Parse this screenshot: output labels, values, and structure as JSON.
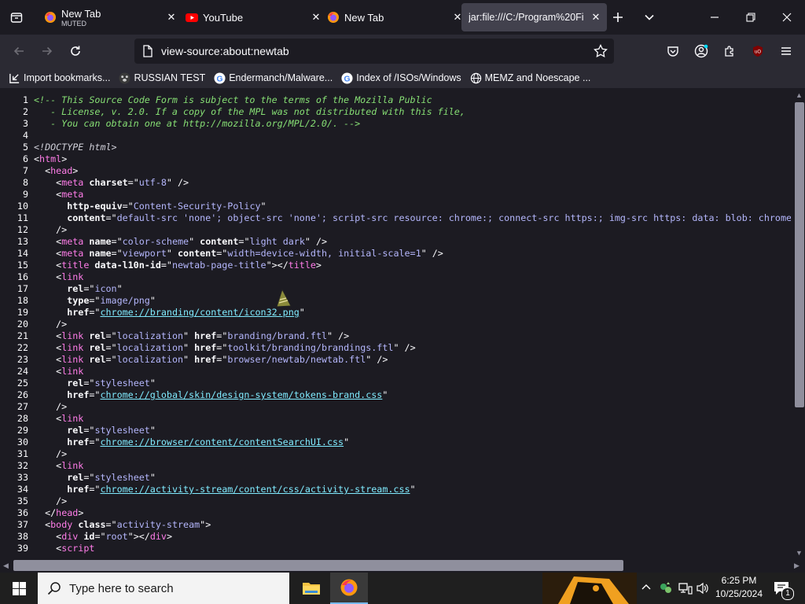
{
  "tabs": [
    {
      "title": "New Tab",
      "subtitle": "MUTED",
      "favicon": "firefox-icon"
    },
    {
      "title": "YouTube",
      "favicon": "youtube-icon"
    },
    {
      "title": "New Tab",
      "favicon": "firefox-icon"
    },
    {
      "title": "jar:file:///C:/Program%20Fi",
      "favicon": "none",
      "active": true
    }
  ],
  "urlbar": {
    "value": "view-source:about:newtab"
  },
  "bookmarks": [
    {
      "label": "Import bookmarks...",
      "icon": "import-icon"
    },
    {
      "label": "RUSSIAN TEST",
      "icon": "paw-icon"
    },
    {
      "label": "Endermanch/Malware...",
      "icon": "google-icon"
    },
    {
      "label": "Index of /ISOs/Windows",
      "icon": "google-icon"
    },
    {
      "label": "MEMZ and Noescape ...",
      "icon": "globe-icon"
    }
  ],
  "source_lines": [
    {
      "n": "1",
      "parts": [
        [
          "cmt",
          "<!-- This Source Code Form is subject to the terms of the Mozilla Public"
        ]
      ]
    },
    {
      "n": "2",
      "parts": [
        [
          "cmt",
          "   - License, v. 2.0. If a copy of the MPL was not distributed with this file,"
        ]
      ]
    },
    {
      "n": "3",
      "parts": [
        [
          "cmt",
          "   - You can obtain one at http://mozilla.org/MPL/2.0/. -->"
        ]
      ]
    },
    {
      "n": "4",
      "parts": []
    },
    {
      "n": "5",
      "parts": [
        [
          "dt",
          "<!DOCTYPE html>"
        ]
      ]
    },
    {
      "n": "6",
      "parts": [
        [
          "txt",
          "<"
        ],
        [
          "tag",
          "html"
        ],
        [
          "txt",
          ">"
        ]
      ]
    },
    {
      "n": "7",
      "parts": [
        [
          "txt",
          "  <"
        ],
        [
          "tag",
          "head"
        ],
        [
          "txt",
          ">"
        ]
      ]
    },
    {
      "n": "8",
      "parts": [
        [
          "txt",
          "    <"
        ],
        [
          "tag",
          "meta"
        ],
        [
          "txt",
          " "
        ],
        [
          "attr",
          "charset"
        ],
        [
          "txt",
          "=\""
        ],
        [
          "val",
          "utf-8"
        ],
        [
          "txt",
          "\" />"
        ]
      ]
    },
    {
      "n": "9",
      "parts": [
        [
          "txt",
          "    <"
        ],
        [
          "tag",
          "meta"
        ]
      ]
    },
    {
      "n": "10",
      "parts": [
        [
          "txt",
          "      "
        ],
        [
          "attr",
          "http-equiv"
        ],
        [
          "txt",
          "=\""
        ],
        [
          "val",
          "Content-Security-Policy"
        ],
        [
          "txt",
          "\""
        ]
      ]
    },
    {
      "n": "11",
      "parts": [
        [
          "txt",
          "      "
        ],
        [
          "attr",
          "content"
        ],
        [
          "txt",
          "=\""
        ],
        [
          "val",
          "default-src 'none'; object-src 'none'; script-src resource: chrome:; connect-src https:; img-src https: data: blob: chrome:"
        ]
      ]
    },
    {
      "n": "12",
      "parts": [
        [
          "txt",
          "    />"
        ]
      ]
    },
    {
      "n": "13",
      "parts": [
        [
          "txt",
          "    <"
        ],
        [
          "tag",
          "meta"
        ],
        [
          "txt",
          " "
        ],
        [
          "attr",
          "name"
        ],
        [
          "txt",
          "=\""
        ],
        [
          "val",
          "color-scheme"
        ],
        [
          "txt",
          "\" "
        ],
        [
          "attr",
          "content"
        ],
        [
          "txt",
          "=\""
        ],
        [
          "val",
          "light dark"
        ],
        [
          "txt",
          "\" />"
        ]
      ]
    },
    {
      "n": "14",
      "parts": [
        [
          "txt",
          "    <"
        ],
        [
          "tag",
          "meta"
        ],
        [
          "txt",
          " "
        ],
        [
          "attr",
          "name"
        ],
        [
          "txt",
          "=\""
        ],
        [
          "val",
          "viewport"
        ],
        [
          "txt",
          "\" "
        ],
        [
          "attr",
          "content"
        ],
        [
          "txt",
          "=\""
        ],
        [
          "val",
          "width=device-width, initial-scale=1"
        ],
        [
          "txt",
          "\" />"
        ]
      ]
    },
    {
      "n": "15",
      "parts": [
        [
          "txt",
          "    <"
        ],
        [
          "tag",
          "title"
        ],
        [
          "txt",
          " "
        ],
        [
          "attr",
          "data-l10n-id"
        ],
        [
          "txt",
          "=\""
        ],
        [
          "val",
          "newtab-page-title"
        ],
        [
          "txt",
          "\"></"
        ],
        [
          "tag",
          "title"
        ],
        [
          "txt",
          ">"
        ]
      ]
    },
    {
      "n": "16",
      "parts": [
        [
          "txt",
          "    <"
        ],
        [
          "tag",
          "link"
        ]
      ]
    },
    {
      "n": "17",
      "parts": [
        [
          "txt",
          "      "
        ],
        [
          "attr",
          "rel"
        ],
        [
          "txt",
          "=\""
        ],
        [
          "val",
          "icon"
        ],
        [
          "txt",
          "\""
        ]
      ]
    },
    {
      "n": "18",
      "parts": [
        [
          "txt",
          "      "
        ],
        [
          "attr",
          "type"
        ],
        [
          "txt",
          "=\""
        ],
        [
          "val",
          "image/png"
        ],
        [
          "txt",
          "\""
        ]
      ]
    },
    {
      "n": "19",
      "parts": [
        [
          "txt",
          "      "
        ],
        [
          "attr",
          "href"
        ],
        [
          "txt",
          "=\""
        ],
        [
          "lnk",
          "chrome://branding/content/icon32.png"
        ],
        [
          "txt",
          "\""
        ]
      ]
    },
    {
      "n": "20",
      "parts": [
        [
          "txt",
          "    />"
        ]
      ]
    },
    {
      "n": "21",
      "parts": [
        [
          "txt",
          "    <"
        ],
        [
          "tag",
          "link"
        ],
        [
          "txt",
          " "
        ],
        [
          "attr",
          "rel"
        ],
        [
          "txt",
          "=\""
        ],
        [
          "val",
          "localization"
        ],
        [
          "txt",
          "\" "
        ],
        [
          "attr",
          "href"
        ],
        [
          "txt",
          "=\""
        ],
        [
          "val",
          "branding/brand.ftl"
        ],
        [
          "txt",
          "\" />"
        ]
      ]
    },
    {
      "n": "22",
      "parts": [
        [
          "txt",
          "    <"
        ],
        [
          "tag",
          "link"
        ],
        [
          "txt",
          " "
        ],
        [
          "attr",
          "rel"
        ],
        [
          "txt",
          "=\""
        ],
        [
          "val",
          "localization"
        ],
        [
          "txt",
          "\" "
        ],
        [
          "attr",
          "href"
        ],
        [
          "txt",
          "=\""
        ],
        [
          "val",
          "toolkit/branding/brandings.ftl"
        ],
        [
          "txt",
          "\" />"
        ]
      ]
    },
    {
      "n": "23",
      "parts": [
        [
          "txt",
          "    <"
        ],
        [
          "tag",
          "link"
        ],
        [
          "txt",
          " "
        ],
        [
          "attr",
          "rel"
        ],
        [
          "txt",
          "=\""
        ],
        [
          "val",
          "localization"
        ],
        [
          "txt",
          "\" "
        ],
        [
          "attr",
          "href"
        ],
        [
          "txt",
          "=\""
        ],
        [
          "val",
          "browser/newtab/newtab.ftl"
        ],
        [
          "txt",
          "\" />"
        ]
      ]
    },
    {
      "n": "24",
      "parts": [
        [
          "txt",
          "    <"
        ],
        [
          "tag",
          "link"
        ]
      ]
    },
    {
      "n": "25",
      "parts": [
        [
          "txt",
          "      "
        ],
        [
          "attr",
          "rel"
        ],
        [
          "txt",
          "=\""
        ],
        [
          "val",
          "stylesheet"
        ],
        [
          "txt",
          "\""
        ]
      ]
    },
    {
      "n": "26",
      "parts": [
        [
          "txt",
          "      "
        ],
        [
          "attr",
          "href"
        ],
        [
          "txt",
          "=\""
        ],
        [
          "lnk",
          "chrome://global/skin/design-system/tokens-brand.css"
        ],
        [
          "txt",
          "\""
        ]
      ]
    },
    {
      "n": "27",
      "parts": [
        [
          "txt",
          "    />"
        ]
      ]
    },
    {
      "n": "28",
      "parts": [
        [
          "txt",
          "    <"
        ],
        [
          "tag",
          "link"
        ]
      ]
    },
    {
      "n": "29",
      "parts": [
        [
          "txt",
          "      "
        ],
        [
          "attr",
          "rel"
        ],
        [
          "txt",
          "=\""
        ],
        [
          "val",
          "stylesheet"
        ],
        [
          "txt",
          "\""
        ]
      ]
    },
    {
      "n": "30",
      "parts": [
        [
          "txt",
          "      "
        ],
        [
          "attr",
          "href"
        ],
        [
          "txt",
          "=\""
        ],
        [
          "lnk",
          "chrome://browser/content/contentSearchUI.css"
        ],
        [
          "txt",
          "\""
        ]
      ]
    },
    {
      "n": "31",
      "parts": [
        [
          "txt",
          "    />"
        ]
      ]
    },
    {
      "n": "32",
      "parts": [
        [
          "txt",
          "    <"
        ],
        [
          "tag",
          "link"
        ]
      ]
    },
    {
      "n": "33",
      "parts": [
        [
          "txt",
          "      "
        ],
        [
          "attr",
          "rel"
        ],
        [
          "txt",
          "=\""
        ],
        [
          "val",
          "stylesheet"
        ],
        [
          "txt",
          "\""
        ]
      ]
    },
    {
      "n": "34",
      "parts": [
        [
          "txt",
          "      "
        ],
        [
          "attr",
          "href"
        ],
        [
          "txt",
          "=\""
        ],
        [
          "lnk",
          "chrome://activity-stream/content/css/activity-stream.css"
        ],
        [
          "txt",
          "\""
        ]
      ]
    },
    {
      "n": "35",
      "parts": [
        [
          "txt",
          "    />"
        ]
      ]
    },
    {
      "n": "36",
      "parts": [
        [
          "txt",
          "  </"
        ],
        [
          "tag",
          "head"
        ],
        [
          "txt",
          ">"
        ]
      ]
    },
    {
      "n": "37",
      "parts": [
        [
          "txt",
          "  <"
        ],
        [
          "tag",
          "body"
        ],
        [
          "txt",
          " "
        ],
        [
          "attr",
          "class"
        ],
        [
          "txt",
          "=\""
        ],
        [
          "val",
          "activity-stream"
        ],
        [
          "txt",
          "\">"
        ]
      ]
    },
    {
      "n": "38",
      "parts": [
        [
          "txt",
          "    <"
        ],
        [
          "tag",
          "div"
        ],
        [
          "txt",
          " "
        ],
        [
          "attr",
          "id"
        ],
        [
          "txt",
          "=\""
        ],
        [
          "val",
          "root"
        ],
        [
          "txt",
          "\"></"
        ],
        [
          "tag",
          "div"
        ],
        [
          "txt",
          ">"
        ]
      ]
    },
    {
      "n": "39",
      "parts": [
        [
          "txt",
          "    <"
        ],
        [
          "tag",
          "script"
        ]
      ]
    }
  ],
  "taskbar": {
    "search_placeholder": "Type here to search",
    "apps": [
      "file-explorer-icon",
      "firefox-icon"
    ],
    "time": "6:25 PM",
    "date": "10/25/2024",
    "notification_count": "1"
  },
  "colors": {
    "accent": "#fbfbfe",
    "tag": "#ff7de9",
    "value": "#b4b6fc",
    "comment": "#86de74",
    "link": "#80ebff"
  }
}
